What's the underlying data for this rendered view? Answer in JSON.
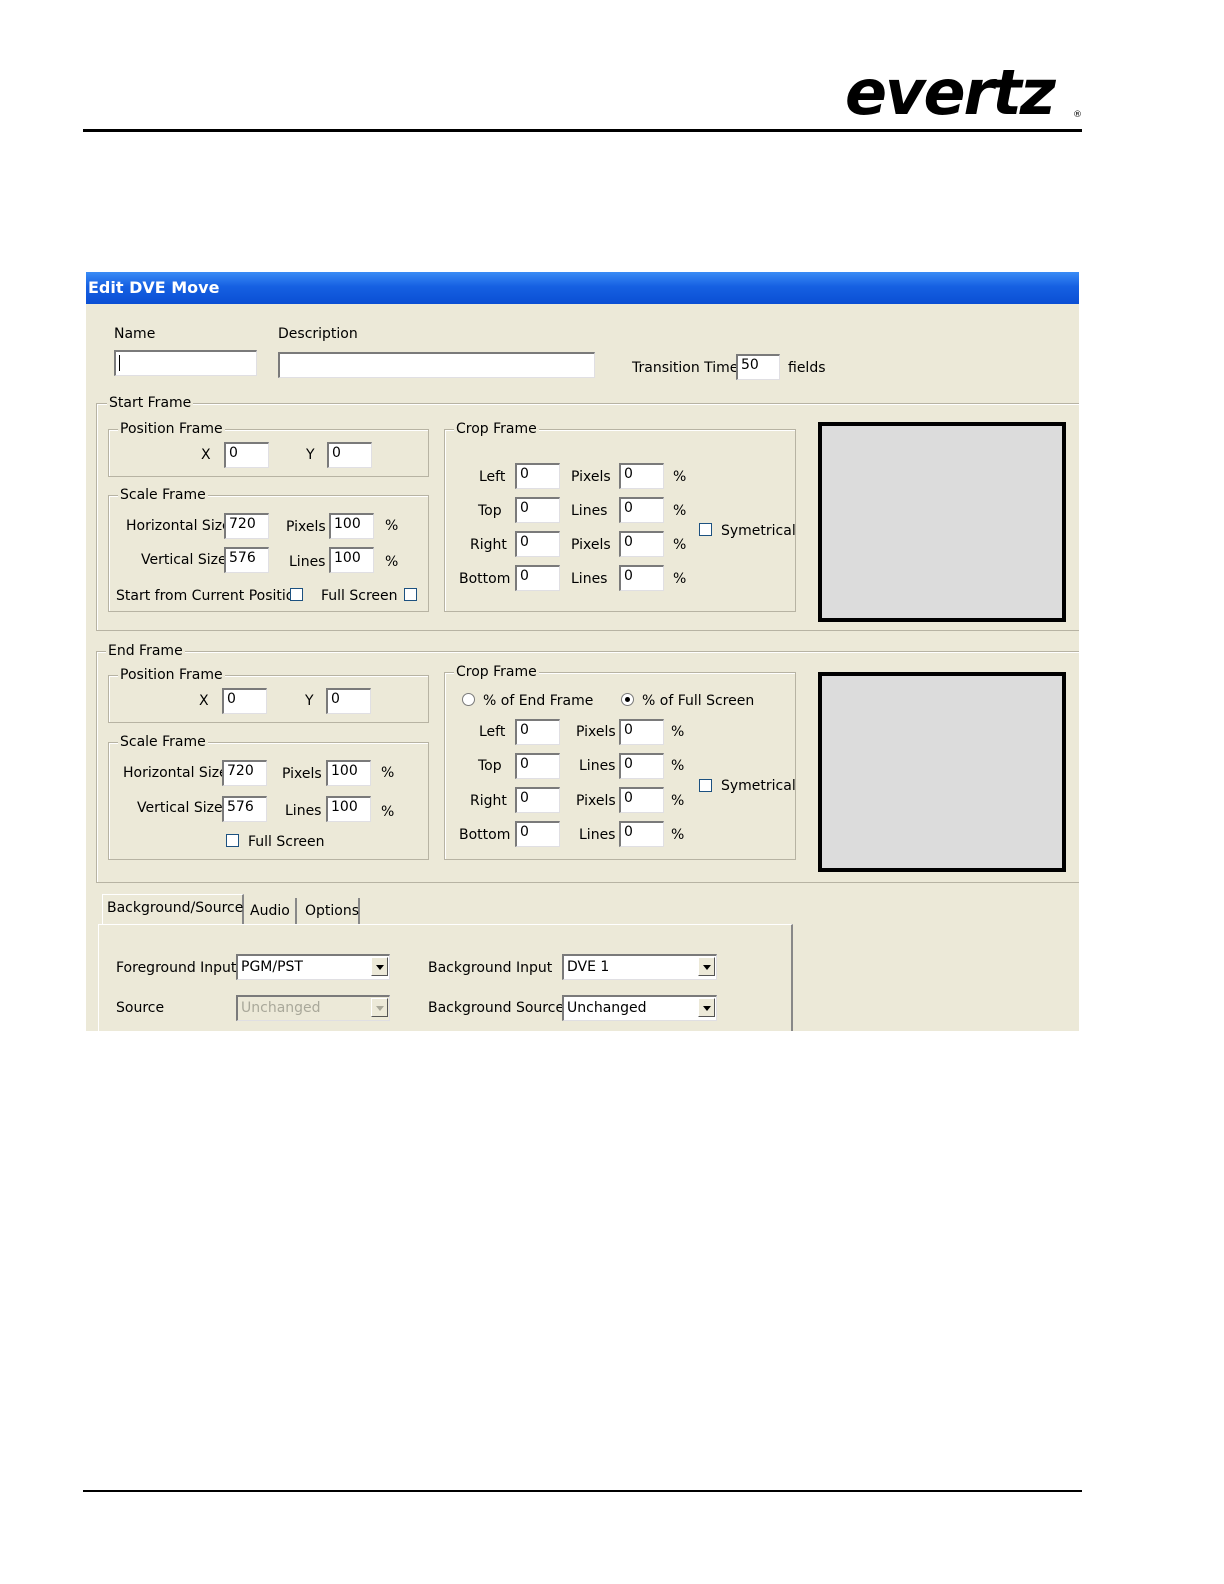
{
  "header": {
    "logo_text": "evertz",
    "logo_reg": "®"
  },
  "dialog": {
    "title": "Edit DVE Move",
    "name_label": "Name",
    "name_value": "",
    "description_label": "Description",
    "description_value": "",
    "transition_time_label": "Transition Time",
    "transition_time_value": "50",
    "transition_time_units": "fields"
  },
  "start_frame": {
    "title": "Start Frame",
    "position": {
      "title": "Position Frame",
      "x_label": "X",
      "x_value": "0",
      "y_label": "Y",
      "y_value": "0"
    },
    "scale": {
      "title": "Scale Frame",
      "h_label": "Horizontal Size",
      "h_value": "720",
      "h_units": "Pixels",
      "h_pct": "100",
      "pct": "%",
      "v_label": "Vertical Size",
      "v_value": "576",
      "v_units": "Lines",
      "v_pct": "100",
      "start_current_label": "Start from Current Position",
      "start_current_checked": false,
      "full_screen_label": "Full Screen",
      "full_screen_checked": false
    },
    "crop": {
      "title": "Crop Frame",
      "left_label": "Left",
      "left_value": "0",
      "left_units": "Pixels",
      "left_pct": "0",
      "top_label": "Top",
      "top_value": "0",
      "top_units": "Lines",
      "top_pct": "0",
      "right_label": "Right",
      "right_value": "0",
      "right_units": "Pixels",
      "right_pct": "0",
      "bottom_label": "Bottom",
      "bottom_value": "0",
      "bottom_units": "Lines",
      "bottom_pct": "0",
      "pct": "%",
      "symetrical_label": "Symetrical",
      "symetrical_checked": false
    }
  },
  "end_frame": {
    "title": "End Frame",
    "position": {
      "title": "Position Frame",
      "x_label": "X",
      "x_value": "0",
      "y_label": "Y",
      "y_value": "0"
    },
    "scale": {
      "title": "Scale Frame",
      "h_label": "Horizontal Size",
      "h_value": "720",
      "h_units": "Pixels",
      "h_pct": "100",
      "pct": "%",
      "v_label": "Vertical Size",
      "v_value": "576",
      "v_units": "Lines",
      "v_pct": "100",
      "full_screen_label": "Full Screen",
      "full_screen_checked": false
    },
    "crop": {
      "title": "Crop Frame",
      "radio_end_frame_label": "% of End Frame",
      "radio_end_frame_selected": false,
      "radio_full_screen_label": "% of Full Screen",
      "radio_full_screen_selected": true,
      "left_label": "Left",
      "left_value": "0",
      "left_units": "Pixels",
      "left_pct": "0",
      "top_label": "Top",
      "top_value": "0",
      "top_units": "Lines",
      "top_pct": "0",
      "right_label": "Right",
      "right_value": "0",
      "right_units": "Pixels",
      "right_pct": "0",
      "bottom_label": "Bottom",
      "bottom_value": "0",
      "bottom_units": "Lines",
      "bottom_pct": "0",
      "pct": "%",
      "symetrical_label": "Symetrical",
      "symetrical_checked": false
    }
  },
  "tabs": [
    {
      "label": "Background/Source",
      "active": true
    },
    {
      "label": "Audio",
      "active": false
    },
    {
      "label": "Options",
      "active": false
    }
  ],
  "background_source": {
    "foreground_input_label": "Foreground Input",
    "foreground_input_value": "PGM/PST",
    "source_label": "Source",
    "source_value": "Unchanged",
    "source_disabled": true,
    "background_input_label": "Background Input",
    "background_input_value": "DVE 1",
    "background_source_label": "Background Source",
    "background_source_value": "Unchanged"
  }
}
